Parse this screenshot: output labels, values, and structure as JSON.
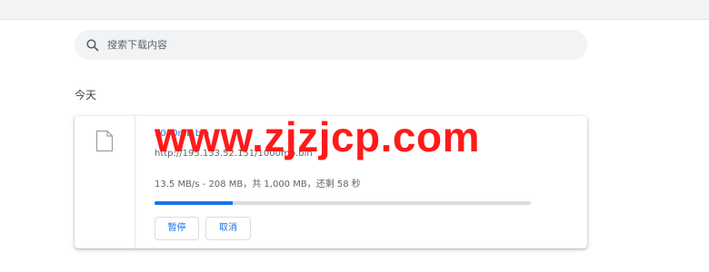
{
  "search": {
    "placeholder": "搜索下载内容"
  },
  "downloads": {
    "date_heading": "今天",
    "item": {
      "file_name": "1000mb.bin",
      "url": "http://195.133.52.151/1000mb.bin",
      "status": "13.5 MB/s - 208 MB，共 1,000 MB，还剩 58 秒",
      "progress_fraction": 0.208,
      "pause_label": "暂停",
      "cancel_label": "取消"
    }
  },
  "watermark": {
    "text": "www.zjzjcp.com"
  },
  "icons": {
    "search": "search-icon",
    "file": "file-icon"
  },
  "colors": {
    "accent": "#1a73e8",
    "watermark": "#ff1a1a",
    "track": "#dadce0"
  }
}
